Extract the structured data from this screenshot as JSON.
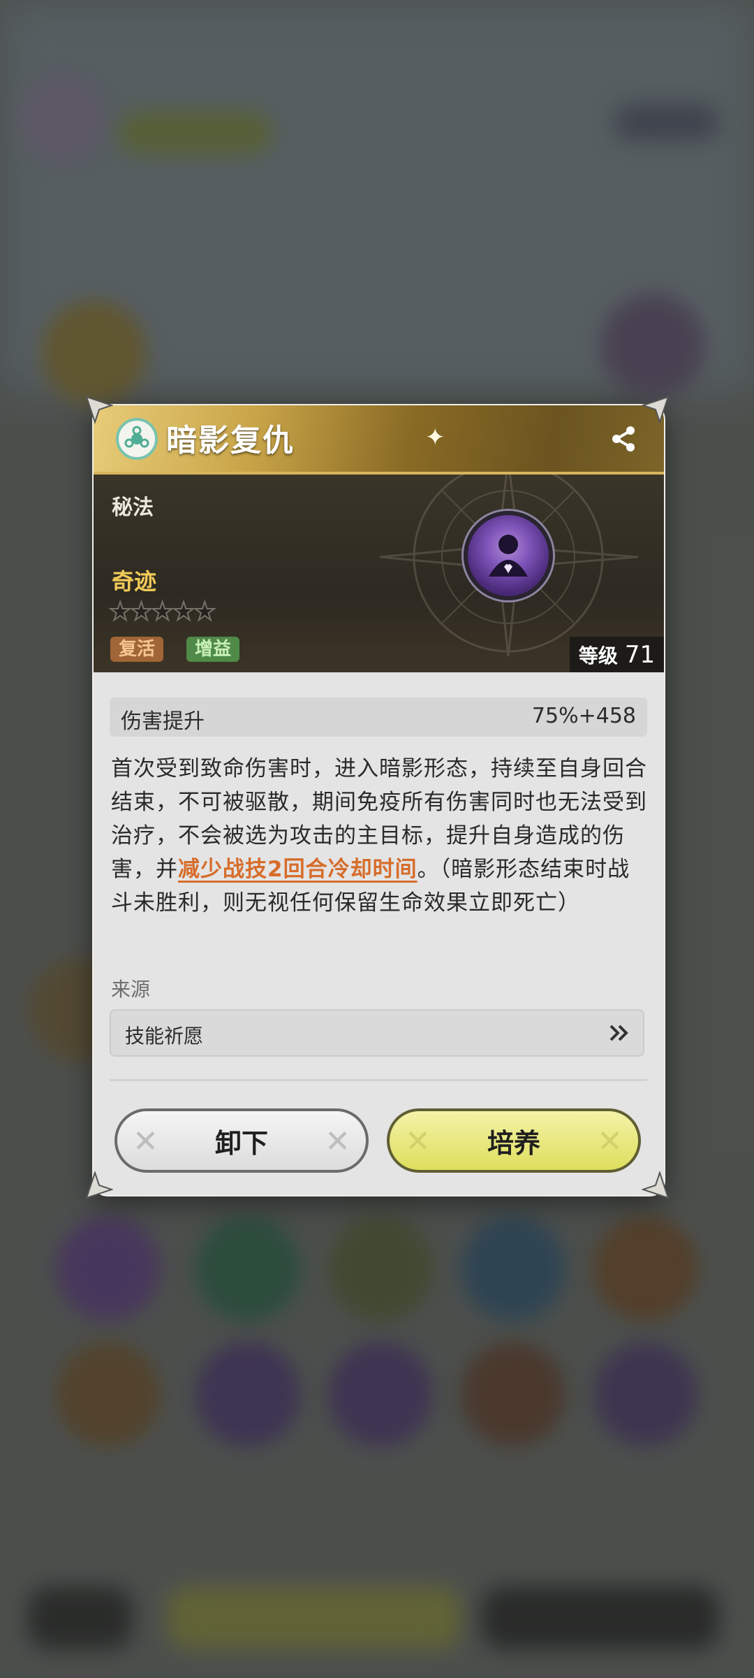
{
  "skill": {
    "title": "暗影复仇",
    "category": "秘法",
    "rarity": "奇迹",
    "stars": "★★★★★",
    "tags": [
      "复活",
      "增益"
    ],
    "level_label": "等级",
    "level": "71",
    "stat": {
      "name": "伤害提升",
      "value": "75%+458"
    },
    "description_before": "首次受到致命伤害时，进入暗影形态，持续至自身回合结束，不可被驱散，期间免疫所有伤害同时也无法受到治疗，不会被选为攻击的主目标，提升自身造成的伤害，并",
    "description_highlight": "减少战技2回合冷却时间",
    "description_after": "。（暗影形态结束时战斗未胜利，则无视任何保留生命效果立即死亡）",
    "source_label": "来源",
    "source_value": "技能祈愿"
  },
  "buttons": {
    "unequip": "卸下",
    "train": "培养"
  },
  "colors": {
    "highlight": "#d66d2b",
    "rarity": "#f1ca57",
    "train_button": "#e8e87a"
  }
}
